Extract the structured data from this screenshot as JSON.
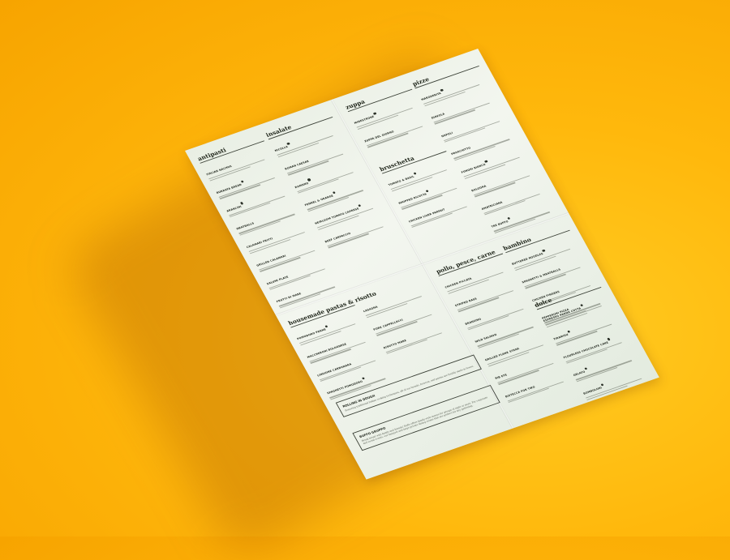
{
  "menu": {
    "panels": [
      {
        "id": "top-left",
        "columns": [
          {
            "title": "antipasti",
            "items": [
              {
                "name": "ITALIAN NACHOS",
                "veg": false
              },
              {
                "name": "BURRATA BREAD",
                "veg": true
              },
              {
                "name": "ARANCINI",
                "veg": true
              },
              {
                "name": "MEATBALLS",
                "veg": false
              },
              {
                "name": "CALAMARI FRITTI",
                "veg": false
              },
              {
                "name": "GRILLED CALAMARI",
                "veg": false
              },
              {
                "name": "SALUMI PLATE",
                "veg": false
              },
              {
                "name": "FRUTTI DI MARE",
                "veg": false
              }
            ]
          },
          {
            "title": "insalate",
            "items": [
              {
                "name": "NICOLLA",
                "veg": true
              },
              {
                "name": "ROMAN CAESAR",
                "veg": false
              },
              {
                "name": "ROMANO",
                "veg": true
              },
              {
                "name": "FENNEL & ORANGE",
                "veg": true
              },
              {
                "name": "HEIRLOOM TOMATO CAPRESE",
                "veg": true
              },
              {
                "name": "BEEF CARPACCIO",
                "veg": false
              }
            ]
          }
        ]
      },
      {
        "id": "top-right",
        "columns": [
          {
            "title": "zuppa",
            "items": [
              {
                "name": "MINESTRONE",
                "veg": true
              },
              {
                "name": "ZUPPA DEL GIORNO",
                "veg": false
              }
            ]
          },
          {
            "title": "bruschetta",
            "items": [
              {
                "name": "TOMATO & BASIL",
                "veg": true
              },
              {
                "name": "WHIPPED RICOTTA",
                "veg": true
              },
              {
                "name": "CHICKEN LIVER PARFAIT",
                "veg": false
              }
            ]
          },
          {
            "title": "pizze",
            "items": [
              {
                "name": "MARGHERITA",
                "veg": true
              },
              {
                "name": "DIAVOLA",
                "veg": false
              },
              {
                "name": "NAPOLI",
                "veg": false
              },
              {
                "name": "PROSCIUTTO",
                "veg": false
              },
              {
                "name": "FUNGHI BIANCO",
                "veg": true
              },
              {
                "name": "BOLOGNA",
                "veg": false
              },
              {
                "name": "AMATRICIANA",
                "veg": false
              },
              {
                "name": "TRE BUFFO",
                "veg": true
              }
            ]
          }
        ]
      },
      {
        "id": "bottom-left",
        "columns": [
          {
            "title": "housemade pastas & risotto",
            "items": [
              {
                "name": "POMODORO PENNE",
                "veg": true
              },
              {
                "name": "MACCHERONI BOLOGNESE",
                "veg": false
              },
              {
                "name": "LINGUINE CARBONARA",
                "veg": false
              },
              {
                "name": "SPAGHETTI POMODORO",
                "veg": true
              }
            ]
          },
          {
            "title": "",
            "items": [
              {
                "name": "LASAGNA",
                "veg": false
              },
              {
                "name": "PORK CAPPELLACCI",
                "veg": false
              },
              {
                "name": "RISOTTO MARE",
                "veg": false
              }
            ]
          }
        ],
        "boxes": [
          {
            "title": "ROLLING IN DOUGH",
            "text": "Honoring traditional Italian cooking techniques, all of our breads, focaccia, and pastas are freshly made in-house."
          },
          {
            "title": "BUFFO GRUPPO",
            "text": "Break bread with family and friends! Buffo offers family-style menus for groups of eight or more. For corporate and social events, our banquet and large private dining rooms that are perfect for any gathering."
          }
        ]
      },
      {
        "id": "bottom-right",
        "columns": [
          {
            "title": "pollo, pesce, carne",
            "items": [
              {
                "name": "CHICKEN PICCATA",
                "veg": false
              },
              {
                "name": "STRIPED BASS",
                "veg": false
              },
              {
                "name": "BRANZINO",
                "veg": false
              },
              {
                "name": "WILD SALMON",
                "veg": false
              },
              {
                "name": "GRILLED FLANK STEAK",
                "veg": false
              },
              {
                "name": "RIB EYE",
                "veg": false
              },
              {
                "name": "BISTECCA FOR TWO",
                "veg": false
              }
            ]
          },
          {
            "title": "bambino",
            "items": [
              {
                "name": "BUTTERED NOODLES",
                "veg": true
              },
              {
                "name": "SPAGHETTI & MEATBALLS",
                "veg": false
              },
              {
                "name": "CHICKEN FINGERS",
                "veg": false
              },
              {
                "name": "PEPPERONI PIZZA",
                "veg": false
              }
            ]
          },
          {
            "title": "dolce",
            "items": [
              {
                "name": "ESPRESSO PANNA COTTA",
                "veg": true
              },
              {
                "name": "TIRAMISU",
                "veg": true
              },
              {
                "name": "FLOURLESS CHOCOLATE CAKE",
                "veg": true
              },
              {
                "name": "GELATO",
                "veg": true
              },
              {
                "name": "BOMBOLONI",
                "veg": true
              }
            ]
          }
        ]
      }
    ]
  },
  "colors": {
    "background": "#ffbb10",
    "paper": "#eef2ea",
    "ink": "#1f251c"
  }
}
